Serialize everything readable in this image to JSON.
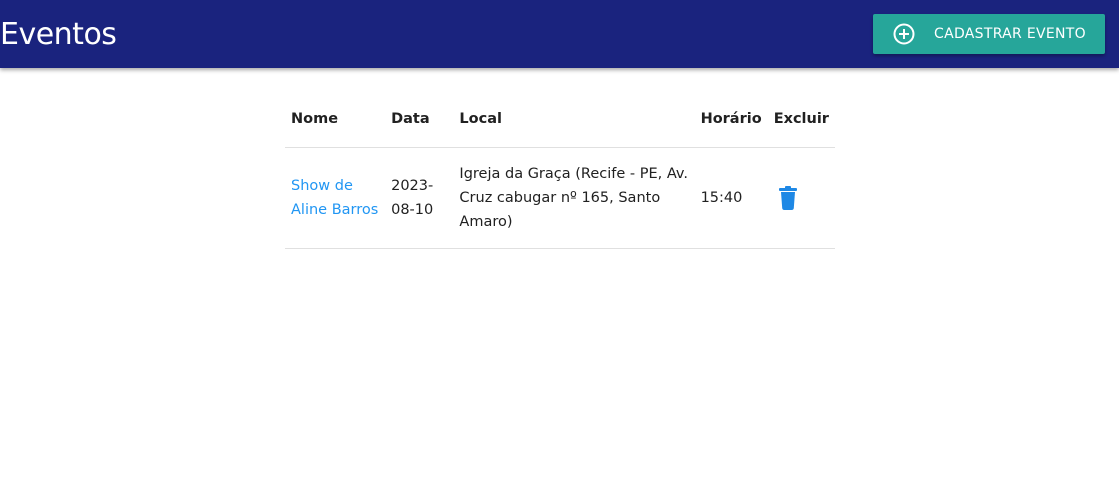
{
  "header": {
    "title": "Eventos",
    "add_button_label": "CADASTRAR EVENTO",
    "add_button_icon": "add-circle-outline-icon",
    "background_color": "#1a237e",
    "button_color": "#26a69a"
  },
  "table": {
    "columns": [
      "Nome",
      "Data",
      "Local",
      "Horário",
      "Excluir"
    ],
    "rows": [
      {
        "name": "Show de Aline Barros",
        "date": "2023-08-10",
        "location": "Igreja da Graça (Recife - PE, Av. Cruz cabugar nº 165, Santo Amaro)",
        "time": "15:40",
        "delete_icon": "trash-icon"
      }
    ],
    "link_color": "#2196f3"
  }
}
